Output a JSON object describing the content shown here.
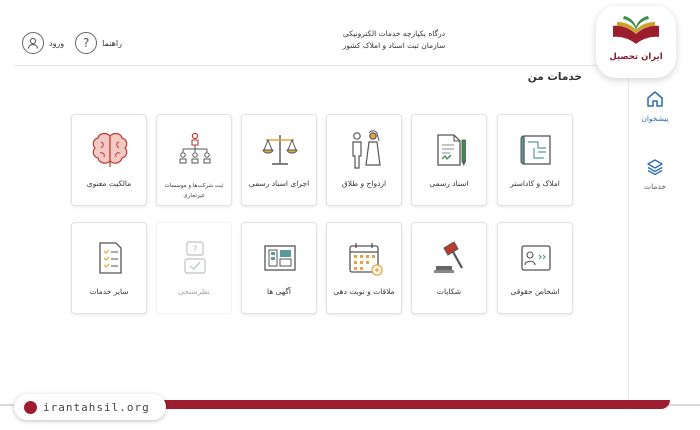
{
  "header": {
    "login_label": "ورود",
    "help_label": "راهنما",
    "org_line1": "درگاه یکپارچه خدمات الکترونیکی",
    "org_line2": "سازمان ثبت اسناد و املاک کشور"
  },
  "page_title": "خدمات من",
  "sidebar": {
    "items": [
      {
        "label": "پیشخوان",
        "icon": "home-icon"
      },
      {
        "label": "خدمات",
        "icon": "layers-icon"
      }
    ]
  },
  "logo": {
    "text": "ایران تحصیل"
  },
  "tiles": [
    {
      "label": "املاک و کاداستر",
      "icon": "cadastre-map-icon",
      "enabled": true
    },
    {
      "label": "اسناد رسمی",
      "icon": "document-pen-icon",
      "enabled": true
    },
    {
      "label": "ازدواج و طلاق",
      "icon": "couple-icon",
      "enabled": true
    },
    {
      "label": "اجرای اسناد رسمی",
      "icon": "scales-icon",
      "enabled": true
    },
    {
      "label": "ثبت شرکت‌ها و موسسات غیرتجاری",
      "icon": "org-chart-icon",
      "enabled": true
    },
    {
      "label": "مالکیت معنوی",
      "icon": "brain-icon",
      "enabled": true
    },
    {
      "label": "اشخاص حقوقی",
      "icon": "id-card-icon",
      "enabled": true
    },
    {
      "label": "شکایات",
      "icon": "gavel-icon",
      "enabled": true
    },
    {
      "label": "ملاقات و نوبت دهی",
      "icon": "calendar-icon",
      "enabled": true
    },
    {
      "label": "آگهی ها",
      "icon": "ad-board-icon",
      "enabled": true
    },
    {
      "label": "نظرسنجی",
      "icon": "survey-icon",
      "enabled": false
    },
    {
      "label": "سایر خدمات",
      "icon": "checklist-icon",
      "enabled": true
    }
  ],
  "footer": {
    "site": "irantahsil.org"
  },
  "colors": {
    "accent": "#2b6cb0",
    "brand": "#9c1d2e",
    "icon_orange": "#e8a33d",
    "icon_teal": "#5a9a9a",
    "icon_red": "#c0392b"
  }
}
